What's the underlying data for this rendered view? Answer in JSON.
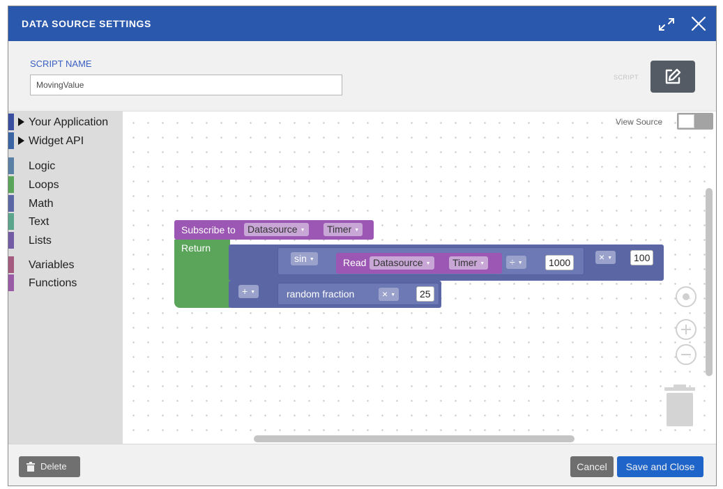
{
  "header": {
    "title": "DATA SOURCE SETTINGS",
    "expand_icon": "expand-icon",
    "close_icon": "close-icon",
    "color": "#2a58ad"
  },
  "script_name": {
    "label": "SCRIPT NAME",
    "value": "MovingValue"
  },
  "script_toggle": {
    "label": "SCRIPT",
    "icon": "edit-icon"
  },
  "toolbox": {
    "items": [
      {
        "label": "Your Application",
        "expandable": true,
        "color": "#3b4fa0"
      },
      {
        "label": "Widget API",
        "expandable": true,
        "color": "#3b64a4"
      },
      {
        "label": "Logic",
        "expandable": false,
        "color": "#5b80a5"
      },
      {
        "label": "Loops",
        "expandable": false,
        "color": "#5ba55b"
      },
      {
        "label": "Math",
        "expandable": false,
        "color": "#5b67a5"
      },
      {
        "label": "Text",
        "expandable": false,
        "color": "#5ba58c"
      },
      {
        "label": "Lists",
        "expandable": false,
        "color": "#745ba5"
      },
      {
        "label": "Variables",
        "expandable": false,
        "color": "#a55b80"
      },
      {
        "label": "Functions",
        "expandable": false,
        "color": "#995ba5"
      }
    ]
  },
  "workspace": {
    "view_source_label": "View Source",
    "view_source_on": false,
    "blocks": {
      "subscribe_label": "Subscribe to",
      "subscribe_source": "Datasource",
      "subscribe_item": "Timer",
      "return_label": "Return",
      "plus_op": "+",
      "sin_label": "sin",
      "read_label": "Read",
      "read_source": "Datasource",
      "read_item": "Timer",
      "divide_op": "÷",
      "divisor": "1000",
      "multiply_op": "×",
      "multiplier": "100",
      "random_label": "random fraction",
      "random_op": "×",
      "random_multiplier": "25"
    }
  },
  "footer": {
    "delete_label": "Delete",
    "cancel_label": "Cancel",
    "save_label": "Save and Close"
  }
}
